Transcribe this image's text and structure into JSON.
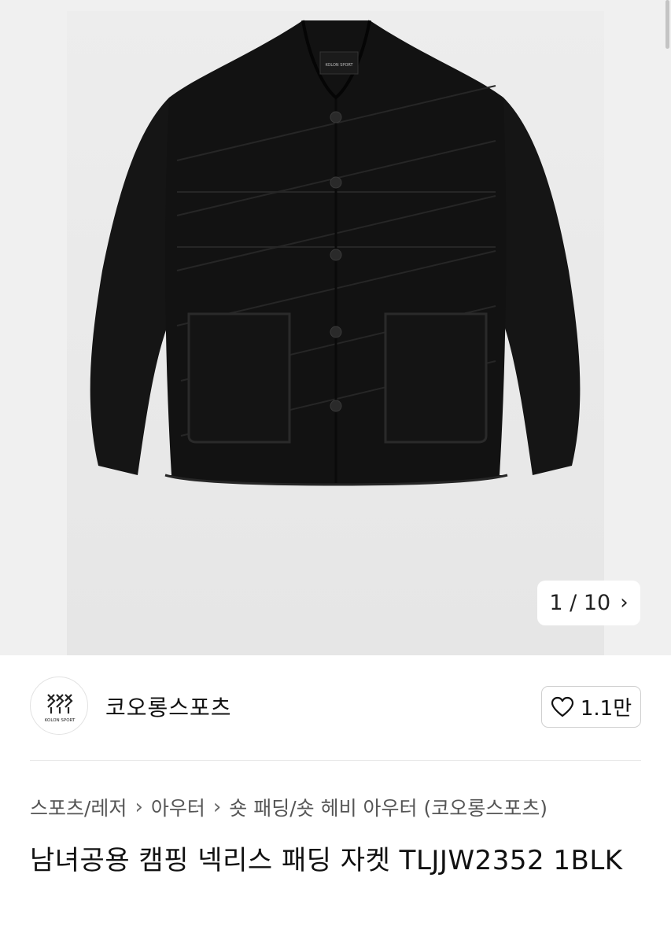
{
  "gallery": {
    "counter_text": "1 / 10",
    "next_glyph": "›",
    "jacket_logo_text": "KOLON SPORT"
  },
  "brand": {
    "name": "코오롱스포츠",
    "logo_text": "KOLON SPORT",
    "logo_icon": "kolon-sport-logo",
    "like_count": "1.1만",
    "like_icon": "heart-outline-icon"
  },
  "breadcrumb": {
    "items": [
      "스포츠/레저",
      "아우터",
      "숏 패딩/숏 헤비 아우터 (코오롱스포츠)"
    ],
    "separator": "›"
  },
  "product": {
    "title": "남녀공용 캠핑 넥리스 패딩 자켓 TLJJW2352 1BLK"
  },
  "colors": {
    "jacket": "#141414",
    "photo_bg": "#e9e9e9",
    "text": "#111111",
    "muted_text": "#555555"
  }
}
